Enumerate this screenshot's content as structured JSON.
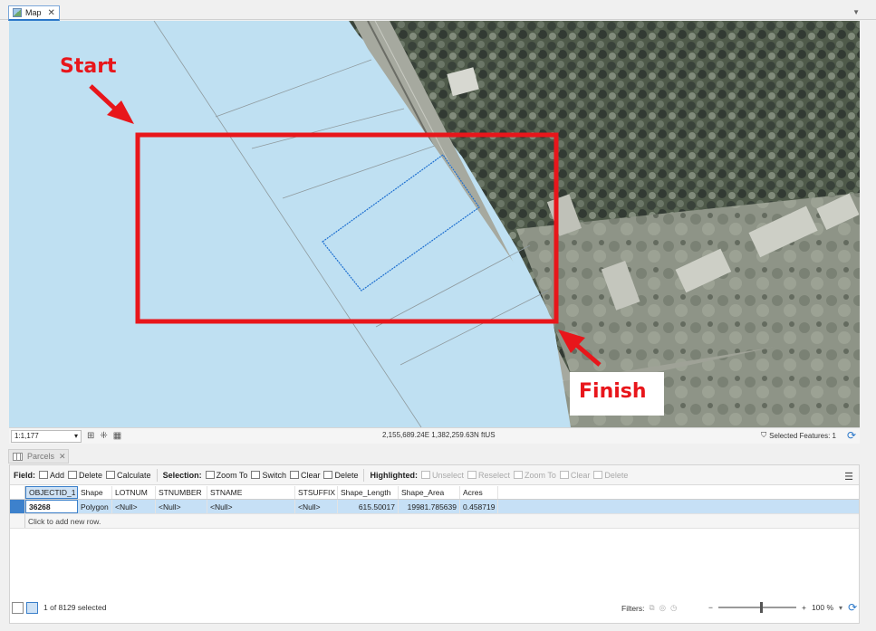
{
  "map_tab": {
    "label": "Map",
    "close": "✕",
    "icon": "map-icon"
  },
  "annotations": {
    "start": "Start",
    "finish": "Finish",
    "color": "#e8161b"
  },
  "map_status": {
    "scale": "1:1,177",
    "coordinates": "2,155,689.24E 1,382,259.63N ftUS",
    "selected_features": "Selected Features: 1"
  },
  "table_tab": {
    "label": "Parcels",
    "close": "✕"
  },
  "toolbar": {
    "field": {
      "label": "Field:",
      "add": "Add",
      "delete": "Delete",
      "calculate": "Calculate"
    },
    "selection": {
      "label": "Selection:",
      "zoom_to": "Zoom To",
      "switch": "Switch",
      "clear": "Clear",
      "delete": "Delete"
    },
    "highlighted": {
      "label": "Highlighted:",
      "unselect": "Unselect",
      "reselect": "Reselect",
      "zoom_to": "Zoom To",
      "clear": "Clear",
      "delete": "Delete"
    }
  },
  "table": {
    "columns": [
      "OBJECTID_1",
      "Shape",
      "LOTNUM",
      "STNUMBER",
      "STNAME",
      "STSUFFIX",
      "Shape_Length",
      "Shape_Area",
      "Acres"
    ],
    "rows": [
      [
        "36268",
        "Polygon",
        "<Null>",
        "<Null>",
        "<Null>",
        "<Null>",
        "615.50017",
        "19981.785639",
        "0.458719"
      ]
    ],
    "new_row": "Click to add new row."
  },
  "bottom_status": {
    "selection_count": "1 of 8129 selected",
    "filters_label": "Filters:",
    "zoom_minus": "−",
    "zoom_plus": "+",
    "zoom_level": "100 %"
  }
}
